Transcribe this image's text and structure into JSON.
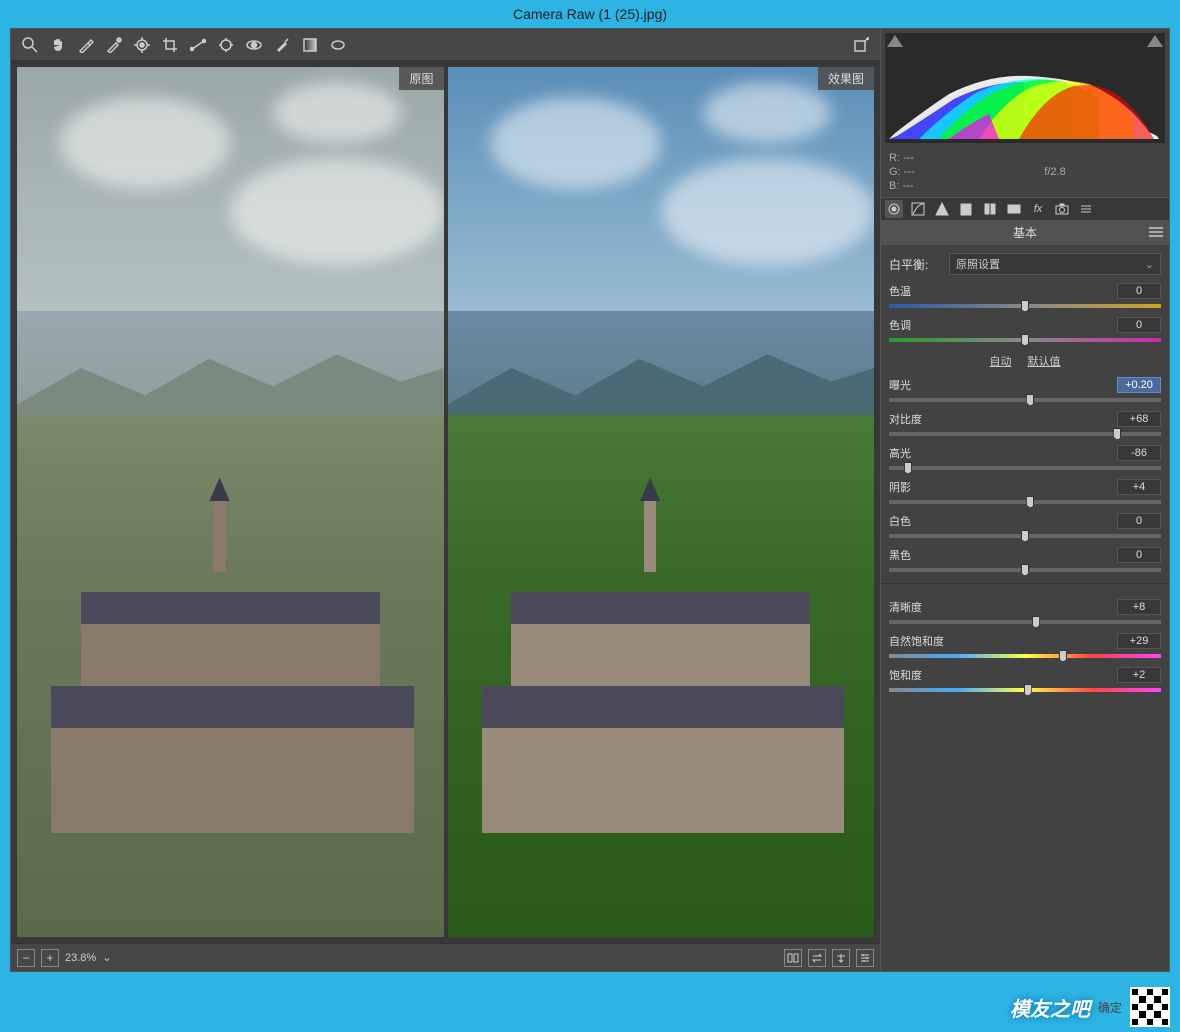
{
  "window": {
    "title": "Camera Raw (1 (25).jpg)"
  },
  "toolbar": {
    "tools": [
      "zoom",
      "hand",
      "eyedropper",
      "sampler",
      "target-adjust",
      "crop",
      "straighten",
      "spot",
      "redeye",
      "brush",
      "gradient",
      "radial"
    ],
    "export": "open-preferences"
  },
  "preview": {
    "before_label": "原图",
    "after_label": "效果图"
  },
  "bottombar": {
    "zoom_value": "23.8%",
    "right_icons": [
      "compare",
      "swap",
      "copy",
      "settings"
    ]
  },
  "histogram": {
    "rgb": {
      "r": "R:",
      "g": "G:",
      "b": "B:",
      "dash": "---"
    },
    "aperture": "f/2.8"
  },
  "tabs": [
    "basic",
    "curve",
    "detail",
    "hsl",
    "split",
    "lens",
    "fx",
    "camera",
    "presets"
  ],
  "panel": {
    "title": "基本",
    "wb": {
      "label": "白平衡:",
      "value": "原照设置"
    },
    "auto": {
      "auto": "自动",
      "default": "默认值"
    },
    "sliders": {
      "temp": {
        "label": "色温",
        "value": "0",
        "pos": 50
      },
      "tint": {
        "label": "色调",
        "value": "0",
        "pos": 50
      },
      "exposure": {
        "label": "曝光",
        "value": "+0.20",
        "pos": 52,
        "active": true
      },
      "contrast": {
        "label": "对比度",
        "value": "+68",
        "pos": 84
      },
      "highlights": {
        "label": "高光",
        "value": "-86",
        "pos": 7
      },
      "shadows": {
        "label": "阴影",
        "value": "+4",
        "pos": 52
      },
      "whites": {
        "label": "白色",
        "value": "0",
        "pos": 50
      },
      "blacks": {
        "label": "黑色",
        "value": "0",
        "pos": 50
      },
      "clarity": {
        "label": "清晰度",
        "value": "+8",
        "pos": 54
      },
      "vibrance": {
        "label": "自然饱和度",
        "value": "+29",
        "pos": 64
      },
      "saturation": {
        "label": "饱和度",
        "value": "+2",
        "pos": 51
      }
    }
  },
  "watermark": {
    "logo": "模友之吧",
    "ok": "确定"
  }
}
